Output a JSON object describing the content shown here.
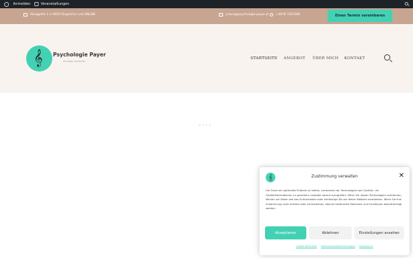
{
  "adminbar": {
    "login_label": "Anmelden",
    "events_label": "Veranstaltungen"
  },
  "infobar": {
    "address": "Riesgplatz 1 in 9020 Klagenfurt  und ONLINE",
    "email": "praxis@psychologie-payer.at",
    "phone": "+4676 1922366",
    "cta_label": "Einen Termin vereinbaren"
  },
  "header": {
    "logo_title": "Psychologie Payer",
    "logo_subtitle": "Die Seele verstanden",
    "nav": [
      {
        "label": "STARTSEITE"
      },
      {
        "label": "ANGEBOT"
      },
      {
        "label": "ÜBER MICH"
      },
      {
        "label": "KONTAKT"
      }
    ]
  },
  "cookie": {
    "title": "Zustimmung verwalten",
    "text": "Um Ihnen ein optimales Erlebnis zu bieten, verwenden wir Technologien wie Cookies, um Geräteinformationen zu speichern und/oder darauf zuzugreifen. Wenn Sie diesen Technologien zustimmen, können wir Daten wie das Surfverhalten oder eindeutige IDs auf dieser Website verarbeiten. Wenn Sie Ihre Zustimmung nicht erteilen oder zurückziehen, können bestimmte Merkmale und Funktionen beeinträchtigt werden.",
    "accept_label": "Akzeptieren",
    "deny_label": "Ablehnen",
    "settings_label": "Einstellungen ansehen",
    "links": [
      {
        "label": "Cookie-Richtlinie"
      },
      {
        "label": "Datenschutzbestimmungen"
      },
      {
        "label": "Impressum"
      }
    ]
  },
  "colors": {
    "accent": "#43d1b4",
    "infobar": "#c8a591",
    "header_bg": "#f9f3ef",
    "adminbar": "#1d2327"
  },
  "icons": [
    "wordpress-icon",
    "calendar-icon",
    "search-icon",
    "house-icon",
    "mail-icon",
    "phone-icon",
    "treble-clef-icon",
    "close-icon"
  ]
}
